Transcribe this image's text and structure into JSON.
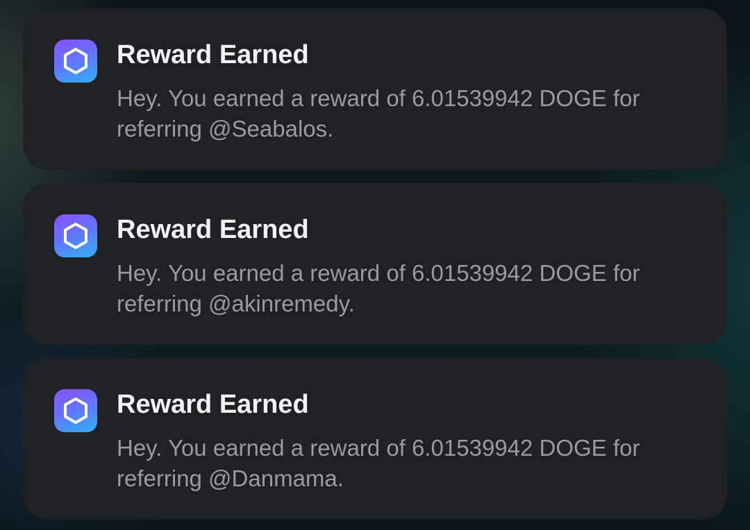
{
  "notifications": [
    {
      "app_icon": "hexagon-icon",
      "title": "Reward Earned",
      "message_line1": "Hey. You earned a reward of 6.01539942 DOGE for",
      "message_line2": "referring @Seabalos."
    },
    {
      "app_icon": "hexagon-icon",
      "title": "Reward Earned",
      "message_line1": "Hey. You earned a reward of 6.01539942 DOGE for",
      "message_line2": "referring @akinremedy."
    },
    {
      "app_icon": "hexagon-icon",
      "title": "Reward Earned",
      "message_line1": "Hey. You earned a reward of 6.01539942 DOGE for",
      "message_line2": "referring @Danmama."
    }
  ],
  "colors": {
    "card_background": "#202123",
    "title": "#f3f3f3",
    "message": "#9b9b9e",
    "icon_gradient_start": "#8a4dff",
    "icon_gradient_end": "#2fb3f5"
  }
}
